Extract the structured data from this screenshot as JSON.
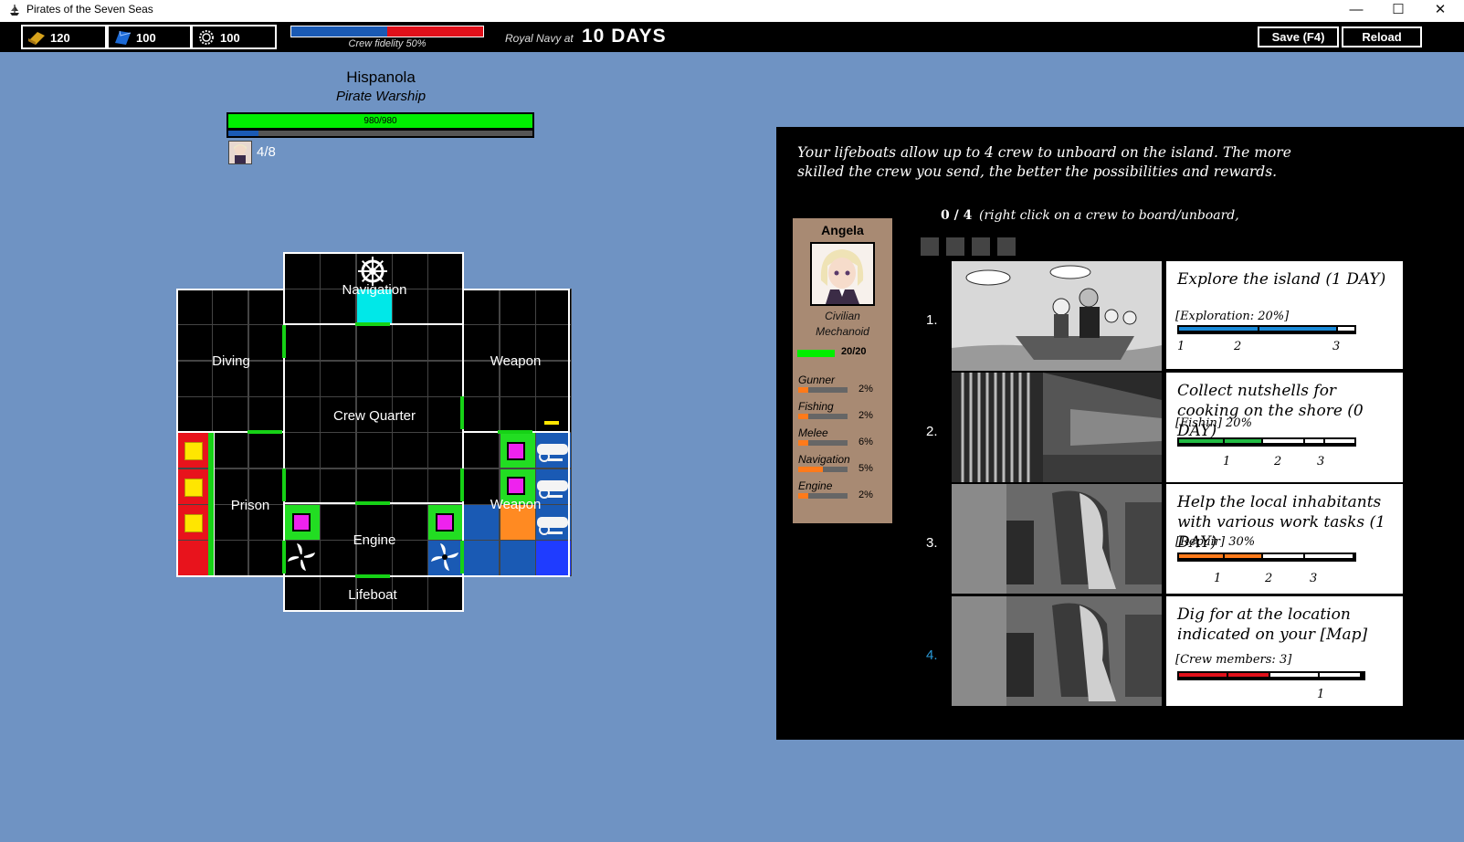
{
  "window": {
    "title": "Pirates of the Seven Seas"
  },
  "hud": {
    "gold": "120",
    "cloth": "100",
    "parts": "100",
    "crew_fidelity_label": "Crew fidelity 50%",
    "crew_fidelity": 0.5,
    "navy_label": "Royal Navy at",
    "navy_days": "10 DAYS",
    "save_label": "Save (F4)",
    "reload_label": "Reload"
  },
  "ship": {
    "name": "Hispanola",
    "type": "Pirate Warship",
    "hp_text": "980/980",
    "hp": 1.0,
    "secondary_level": 0.1,
    "crew_count": "4/8",
    "rooms": {
      "navigation": "Navigation",
      "diving": "Diving",
      "weapon_top": "Weapon",
      "crew_quarter": "Crew Quarter",
      "prison": "Prison",
      "engine": "Engine",
      "weapon_bottom": "Weapon",
      "lifeboat": "Lifeboat"
    }
  },
  "island": {
    "intro": "Your lifeboats allow up to 4 crew to unboard on the island. The more skilled the crew you send, the better the possibilities and rewards.",
    "board_count": "0 / 4",
    "board_hint": "(right click on a crew to board/unboard,",
    "crew": {
      "name": "Angela",
      "class_line1": "Civilian",
      "class_line2": "Mechanoid",
      "hp": "20/20",
      "skills": [
        {
          "name": "Gunner",
          "pct": "2%",
          "level": 0.2
        },
        {
          "name": "Fishing",
          "pct": "2%",
          "level": 0.2
        },
        {
          "name": "Melee",
          "pct": "6%",
          "level": 0.2
        },
        {
          "name": "Navigation",
          "pct": "5%",
          "level": 0.5
        },
        {
          "name": "Engine",
          "pct": "2%",
          "level": 0.2
        }
      ]
    },
    "tasks": [
      {
        "num": "1.",
        "title": "Explore the island  (1 DAY)",
        "req": "[Exploration: 20%]",
        "ticks": [
          "1",
          "2",
          "3"
        ]
      },
      {
        "num": "2.",
        "title": "Collect nutshells for cooking on the shore  (0 DAY)",
        "req": "[Fishin] 20%",
        "ticks": [
          "1",
          "2",
          "3"
        ]
      },
      {
        "num": "3.",
        "title": "Help the local inhabitants with various work tasks (1 DAY)",
        "req": "[Repair] 30%",
        "ticks": [
          "1",
          "2",
          "3"
        ]
      },
      {
        "num": "4.",
        "title": "Dig for at the location indicated on your [Map]",
        "req": "[Crew members: 3]",
        "ticks": [
          "1"
        ]
      }
    ]
  }
}
